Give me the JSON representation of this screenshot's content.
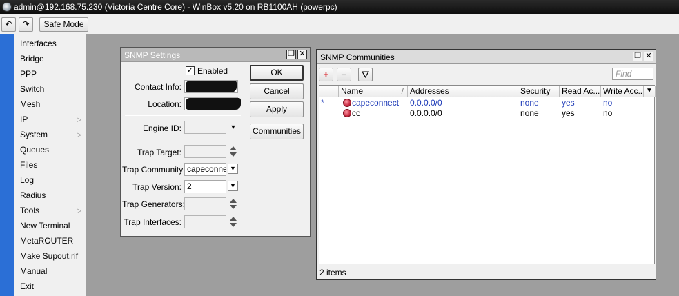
{
  "app": {
    "title": "admin@192.168.75.230 (Victoria Centre Core) - WinBox v5.20 on RB1100AH (powerpc)"
  },
  "toolbar": {
    "undo_icon": "↶",
    "redo_icon": "↷",
    "safe_mode_label": "Safe Mode"
  },
  "sidebar": {
    "items": [
      {
        "label": "Interfaces",
        "has_submenu": false
      },
      {
        "label": "Bridge",
        "has_submenu": false
      },
      {
        "label": "PPP",
        "has_submenu": false
      },
      {
        "label": "Switch",
        "has_submenu": false
      },
      {
        "label": "Mesh",
        "has_submenu": false
      },
      {
        "label": "IP",
        "has_submenu": true
      },
      {
        "label": "System",
        "has_submenu": true
      },
      {
        "label": "Queues",
        "has_submenu": false
      },
      {
        "label": "Files",
        "has_submenu": false
      },
      {
        "label": "Log",
        "has_submenu": false
      },
      {
        "label": "Radius",
        "has_submenu": false
      },
      {
        "label": "Tools",
        "has_submenu": true
      },
      {
        "label": "New Terminal",
        "has_submenu": false
      },
      {
        "label": "MetaROUTER",
        "has_submenu": false
      },
      {
        "label": "Make Supout.rif",
        "has_submenu": false
      },
      {
        "label": "Manual",
        "has_submenu": false
      },
      {
        "label": "Exit",
        "has_submenu": false
      }
    ],
    "submenu_arrow": "▷"
  },
  "snmp_settings": {
    "title": "SNMP Settings",
    "enabled_label": "Enabled",
    "enabled_checked": true,
    "check_mark": "✓",
    "contact_info_label": "Contact Info:",
    "location_label": "Location:",
    "engine_id_label": "Engine ID:",
    "engine_id_value": "",
    "trap_target_label": "Trap Target:",
    "trap_target_value": "",
    "trap_community_label": "Trap Community:",
    "trap_community_value": "capeconne",
    "trap_version_label": "Trap Version:",
    "trap_version_value": "2",
    "trap_generators_label": "Trap Generators:",
    "trap_generators_value": "",
    "trap_interfaces_label": "Trap Interfaces:",
    "trap_interfaces_value": "",
    "buttons": {
      "ok": "OK",
      "cancel": "Cancel",
      "apply": "Apply",
      "communities": "Communities"
    },
    "restore_icon": "❐",
    "close_icon": "✕",
    "dropdown_icon": "▼"
  },
  "snmp_communities": {
    "title": "SNMP Communities",
    "add_icon": "+",
    "remove_icon": "−",
    "filter_icon": "⛛",
    "find_placeholder": "Find",
    "columns": [
      "Name",
      "Addresses",
      "Security",
      "Read Ac...",
      "Write Acc..."
    ],
    "sort_indicator": "/",
    "rows": [
      {
        "flag": "*",
        "name": "capeconnect",
        "addresses": "0.0.0.0/0",
        "security": "none",
        "read": "yes",
        "write": "no",
        "default": true
      },
      {
        "flag": "",
        "name": "cc",
        "addresses": "0.0.0.0/0",
        "security": "none",
        "read": "yes",
        "write": "no",
        "default": false
      }
    ],
    "status": "2 items"
  },
  "colors": {
    "accent_strip": "#2b6fd6",
    "default_row_text": "#1f3cb8",
    "workspace_bg": "#9e9e9e"
  }
}
